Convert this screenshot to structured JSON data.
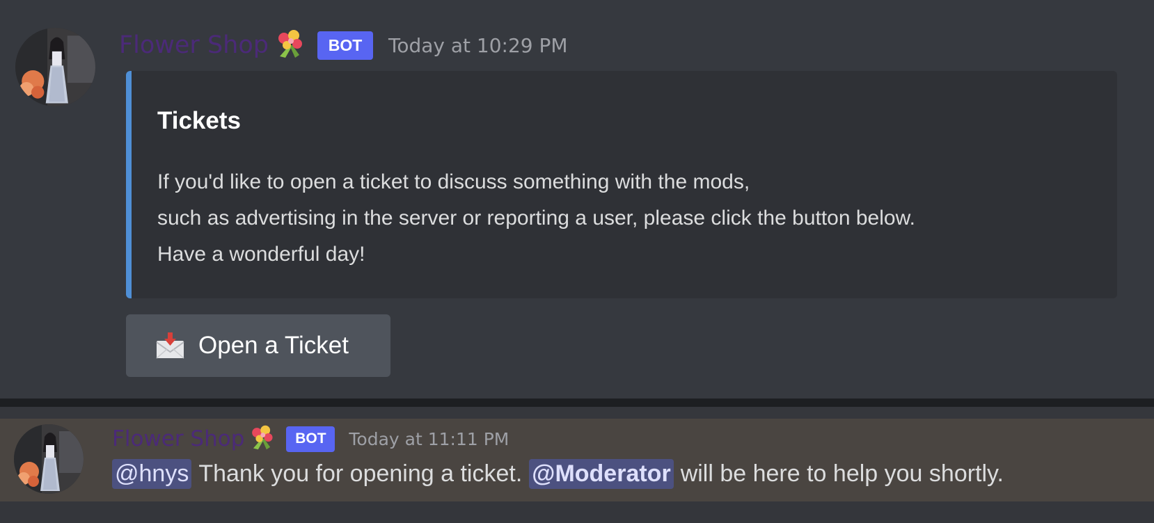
{
  "messages": [
    {
      "username": "Flower Shop",
      "bot_tag": "BOT",
      "timestamp": "Today at 10:29 PM",
      "embed": {
        "title": "Tickets",
        "description_lines": [
          "If you'd like to open a ticket to discuss something with the mods,",
          "such as advertising in the server or reporting a user, please click the button below.",
          "Have a wonderful day!"
        ],
        "accent_color": "#4f8fd6"
      },
      "button": {
        "icon": "envelope-with-arrow-icon",
        "label": "Open a Ticket"
      }
    },
    {
      "username": "Flower Shop",
      "bot_tag": "BOT",
      "timestamp": "Today at 11:11 PM",
      "mention_user": "@hnys",
      "text_mid": "Thank you for opening a ticket.",
      "mention_role": "@Moderator",
      "text_end": "will be here to help you shortly."
    }
  ],
  "colors": {
    "username": "#4b2a78",
    "bot_tag": "#5865f2",
    "mention_bg": "#4c5180",
    "highlight_bg": "#4a4541"
  }
}
